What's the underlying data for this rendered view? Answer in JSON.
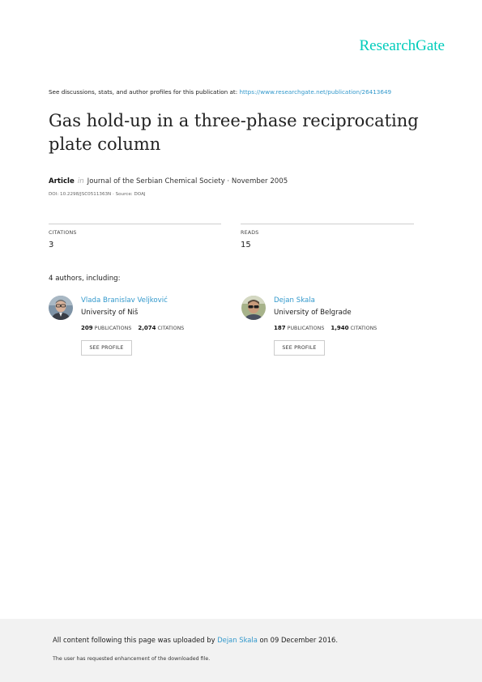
{
  "brand": {
    "logo_text": "ResearchGate",
    "color": "#00ccbb"
  },
  "intro": {
    "text": "See discussions, stats, and author profiles for this publication at:",
    "url": "https://www.researchgate.net/publication/26413649"
  },
  "publication": {
    "title": "Gas hold-up in a three-phase reciprocating plate column",
    "type": "Article",
    "in_word": "in",
    "venue_date": "Journal of the Serbian Chemical Society · November 2005",
    "doi_source": "DOI: 10.2298/JSC0511363N · Source: DOAJ"
  },
  "stats": {
    "citations_label": "CITATIONS",
    "citations_value": "3",
    "reads_label": "READS",
    "reads_value": "15"
  },
  "authors_heading_count": "4 authors",
  "authors_heading_rest": ", including:",
  "authors": [
    {
      "name": "Vlada Branislav Veljković",
      "institution": "University of Niš",
      "publications": "209",
      "publications_label": "PUBLICATIONS",
      "citations": "2,074",
      "citations_label": "CITATIONS",
      "button": "SEE PROFILE"
    },
    {
      "name": "Dejan Skala",
      "institution": "University of Belgrade",
      "publications": "187",
      "publications_label": "PUBLICATIONS",
      "citations": "1,940",
      "citations_label": "CITATIONS",
      "button": "SEE PROFILE"
    }
  ],
  "footer": {
    "upload_prefix": "All content following this page was uploaded by",
    "uploader": "Dejan Skala",
    "upload_suffix": "on 09 December 2016.",
    "note": "The user has requested enhancement of the downloaded file."
  }
}
